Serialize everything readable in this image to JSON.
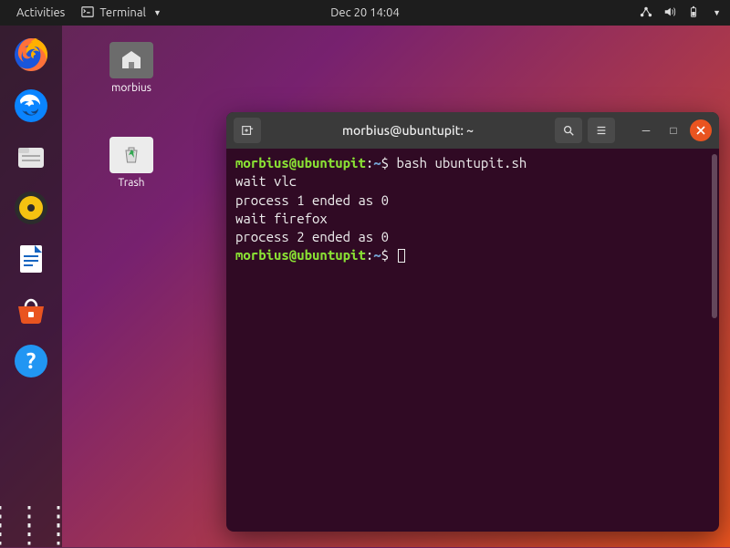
{
  "topbar": {
    "activities": "Activities",
    "app_name": "Terminal",
    "datetime": "Dec 20  14:04"
  },
  "desktop": {
    "home_folder_label": "morbius",
    "trash_label": "Trash"
  },
  "terminal": {
    "title": "morbius@ubuntupit: ~",
    "prompt_user": "morbius@ubuntupit",
    "prompt_sep": ":",
    "prompt_path": "~",
    "prompt_end": "$ ",
    "cmd1": "bash ubuntupit.sh",
    "out1": "wait vlc",
    "out2": "process 1 ended as 0",
    "out3": "wait firefox",
    "out4": "process 2 ended as 0"
  }
}
